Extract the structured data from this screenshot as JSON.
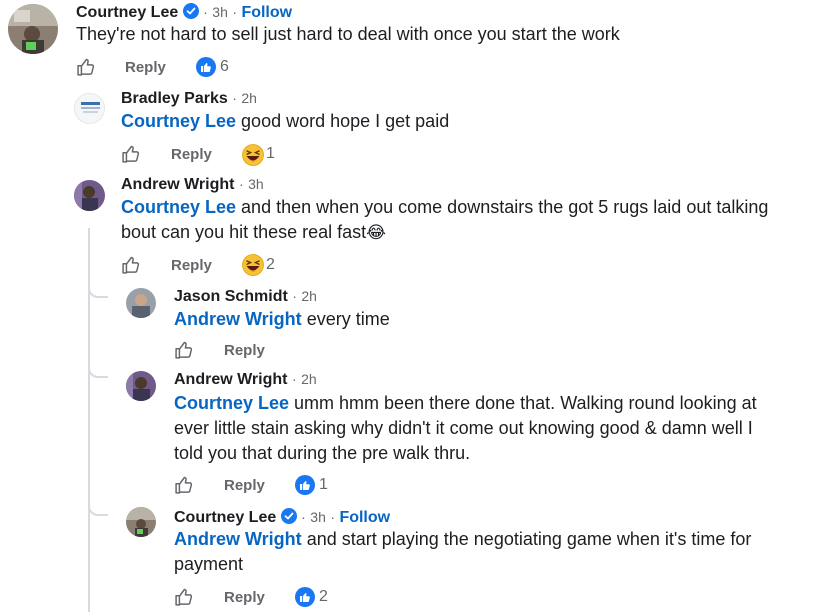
{
  "comments": [
    {
      "name": "Courtney Lee",
      "verified": true,
      "time": "3h",
      "follow": "Follow",
      "text": "They're not hard to sell just hard to deal with once you start the work",
      "reply": "Reply",
      "reaction": "like",
      "count": "6"
    },
    {
      "name": "Bradley Parks",
      "time": "2h",
      "mention": "Courtney Lee",
      "text": "good word hope I get paid",
      "reply": "Reply",
      "reaction": "haha",
      "count": "1"
    },
    {
      "name": "Andrew Wright",
      "time": "3h",
      "mention": "Courtney Lee",
      "text_line1": "and then when you come downstairs the got 5 rugs laid out talking",
      "text_line2": "bout can you hit these real fast",
      "emoji": "😂",
      "reply": "Reply",
      "reaction": "haha",
      "count": "2"
    },
    {
      "name": "Jason Schmidt",
      "time": "2h",
      "mention": "Andrew Wright",
      "text": "every time",
      "reply": "Reply"
    },
    {
      "name": "Andrew Wright",
      "time": "2h",
      "mention": "Courtney Lee",
      "text_line1": "umm hmm been there done that. Walking round looking at",
      "text_line2": "ever little stain asking why didn't it come out knowing good & damn well I",
      "text_line3": "told you that during the pre walk thru.",
      "reply": "Reply",
      "reaction": "like",
      "count": "1"
    },
    {
      "name": "Courtney Lee",
      "verified": true,
      "time": "3h",
      "follow": "Follow",
      "mention": "Andrew Wright",
      "text_line1": "and start playing the negotiating game when it's time for",
      "text_line2": "payment",
      "reply": "Reply",
      "reaction": "like",
      "count": "2"
    }
  ],
  "dot": "·",
  "colors": {
    "link": "#0866c2",
    "muted": "#65676b",
    "like_blue": "#1877f2",
    "thread_line": "#d8dadf"
  },
  "icons": {
    "like": "thumbs-up-outline-icon",
    "verified": "verified-badge-icon",
    "reaction_like": "like-reaction-icon",
    "reaction_haha": "haha-reaction-icon"
  }
}
